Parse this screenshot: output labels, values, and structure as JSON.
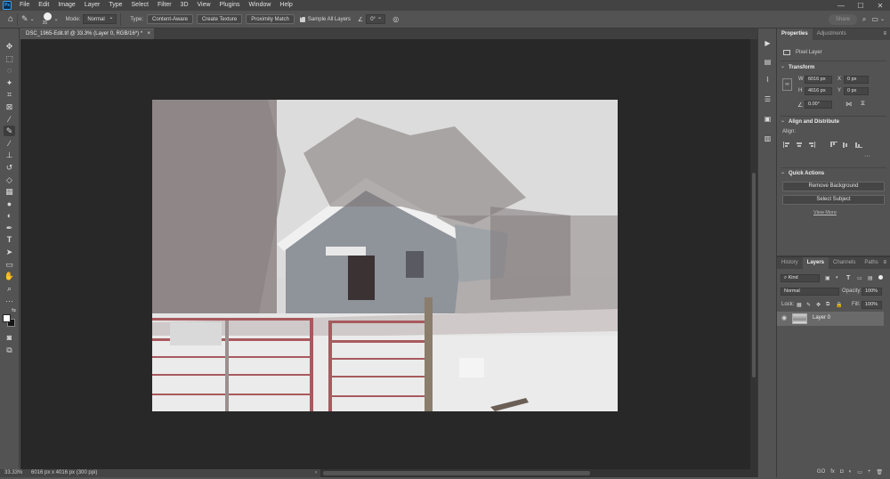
{
  "menubar": {
    "logo": "Ps",
    "items": [
      "File",
      "Edit",
      "Image",
      "Layer",
      "Type",
      "Select",
      "Filter",
      "3D",
      "View",
      "Plugins",
      "Window",
      "Help"
    ],
    "window_controls": [
      "—",
      "☐",
      "✕"
    ]
  },
  "options": {
    "brush_size": "35",
    "mode_label": "Mode:",
    "mode_value": "Normal",
    "type_label": "Type:",
    "type_buttons": [
      "Content-Aware",
      "Create Texture",
      "Proximity Match"
    ],
    "sample_all_layers": "Sample All Layers",
    "angle_value": "0°",
    "share_label": "Share"
  },
  "document": {
    "tab_title": "DSC_1965-Edit.tif @ 33.3% (Layer 0, RGB/16*) *"
  },
  "status": {
    "zoom": "33.33%",
    "doc_info": "6016 px x 4016 px (300 ppi)"
  },
  "properties": {
    "tabs": [
      "Properties",
      "Adjustments"
    ],
    "layer_type": "Pixel Layer",
    "transform_title": "Transform",
    "w_label": "W",
    "w_value": "6016 px",
    "h_label": "H",
    "h_value": "4016 px",
    "x_label": "X",
    "x_value": "0 px",
    "y_label": "Y",
    "y_value": "0 px",
    "angle_value": "0.00°",
    "align_title": "Align and Distribute",
    "align_label": "Align:",
    "quick_actions_title": "Quick Actions",
    "remove_bg": "Remove Background",
    "select_subject": "Select Subject",
    "view_more": "View More"
  },
  "layers": {
    "tabs": [
      "History",
      "Layers",
      "Channels",
      "Paths"
    ],
    "filter_kind": "Kind",
    "blend_mode": "Normal",
    "opacity_label": "Opacity:",
    "opacity_value": "100%",
    "lock_label": "Lock:",
    "fill_label": "Fill:",
    "fill_value": "100%",
    "layer_name": "Layer 0",
    "bottom_icons": [
      "GO",
      "fx",
      "◘",
      "◐",
      "▭",
      "+",
      "🗑"
    ]
  }
}
